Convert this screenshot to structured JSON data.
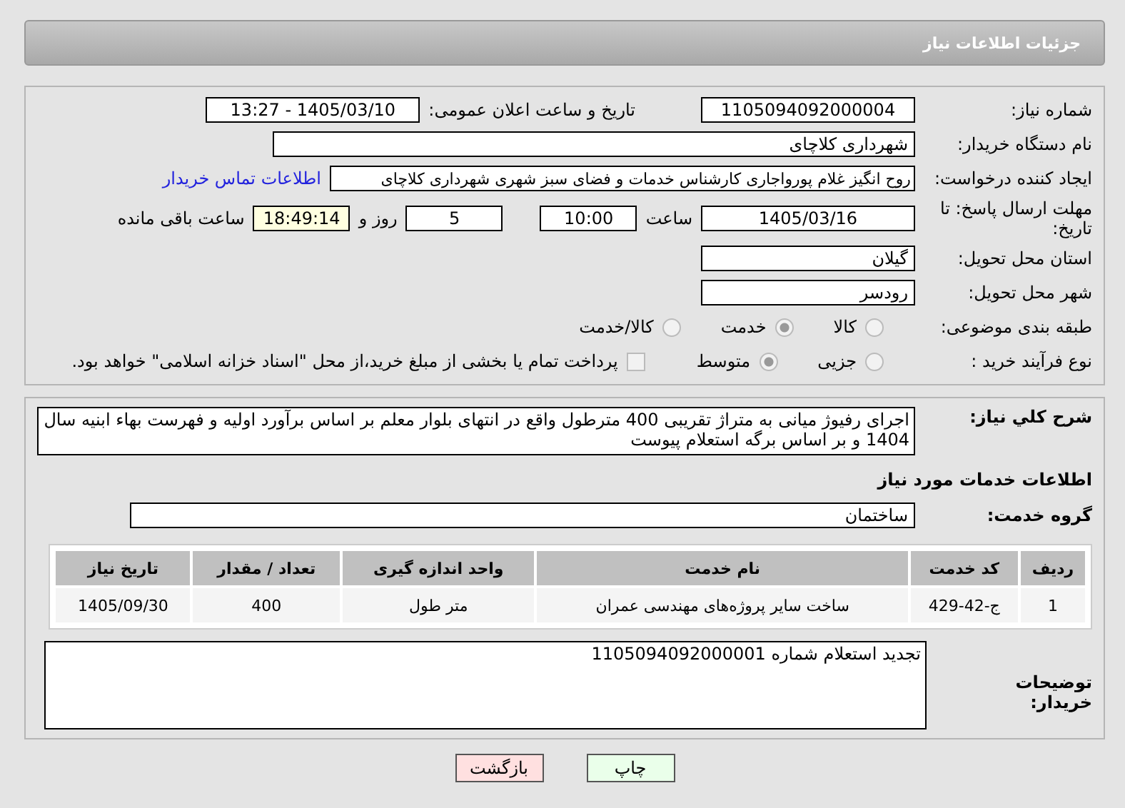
{
  "header": {
    "title": "جزئیات اطلاعات نیاز"
  },
  "form": {
    "need_number": {
      "label": "شماره نیاز:",
      "value": "1105094092000004"
    },
    "announce": {
      "label": "تاریخ و ساعت اعلان عمومی:",
      "value": "1405/03/10 - 13:27"
    },
    "buyer": {
      "label": "نام دستگاه خریدار:",
      "value": "شهرداری کلاچای"
    },
    "creator": {
      "label": "ایجاد کننده درخواست:",
      "value": "روح انگیز غلام پورواجاری کارشناس خدمات و فضای سبز شهری شهرداری کلاچای",
      "link": "اطلاعات تماس خریدار"
    },
    "deadline": {
      "label": "مهلت ارسال پاسخ: تا تاریخ:",
      "date": "1405/03/16",
      "time_label": "ساعت",
      "time": "10:00",
      "days": "5",
      "days_label": "روز و",
      "remaining": "18:49:14",
      "remaining_label": "ساعت باقی مانده"
    },
    "province": {
      "label": "استان محل تحویل:",
      "value": "گیلان"
    },
    "city": {
      "label": "شهر محل تحویل:",
      "value": "رودسر"
    },
    "category": {
      "label": "طبقه بندی موضوعی:",
      "options": [
        {
          "label": "کالا",
          "selected": false
        },
        {
          "label": "خدمت",
          "selected": true
        },
        {
          "label": "کالا/خدمت",
          "selected": false
        }
      ]
    },
    "process": {
      "label": "نوع فرآیند خرید :",
      "options": [
        {
          "label": "جزیی",
          "selected": false
        },
        {
          "label": "متوسط",
          "selected": true
        }
      ],
      "payment": {
        "checked": false,
        "text": "پرداخت تمام یا بخشی از مبلغ خرید،از محل \"اسناد خزانه اسلامی\" خواهد بود."
      }
    }
  },
  "details": {
    "description": {
      "label": "شرح کلي نياز:",
      "value": "اجرای رفیوژ میانی به متراژ تقریبی 400 مترطول واقع در انتهای بلوار معلم بر اساس برآورد اولیه و فهرست بهاء ابنیه سال 1404 و بر اساس برگه استعلام پیوست"
    },
    "section_title": "اطلاعات خدمات مورد نیاز",
    "service_group": {
      "label": "گروه خدمت:",
      "value": "ساختمان"
    },
    "table": {
      "columns": [
        "ردیف",
        "کد خدمت",
        "نام خدمت",
        "واحد اندازه گیری",
        "تعداد / مقدار",
        "تاریخ نیاز"
      ],
      "rows": [
        [
          "1",
          "ج-42-429",
          "ساخت سایر پروژه‌های مهندسی عمران",
          "متر طول",
          "400",
          "1405/09/30"
        ]
      ]
    },
    "notes": {
      "label": "توضیحات خریدار:",
      "value": "تجدید استعلام شماره 1105094092000001"
    }
  },
  "buttons": [
    {
      "kind": "print",
      "label": "چاپ"
    },
    {
      "kind": "back",
      "label": "بازگشت"
    }
  ]
}
